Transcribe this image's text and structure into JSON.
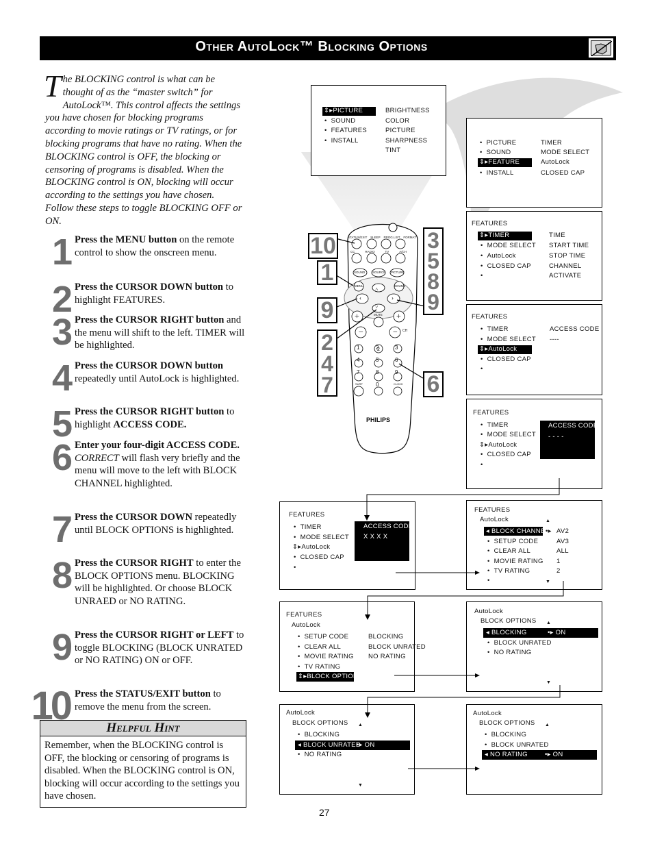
{
  "header": {
    "title": "Other AutoLock™ Blocking Options",
    "icon": "no-hand-icon"
  },
  "intro": {
    "dropcap": "T",
    "text": "he BLOCKING control is what can be thought of as the “master switch” for AutoLock™. This control affects the settings you have chosen for blocking programs according to movie ratings or TV ratings, or for blocking programs that have no rating. When the BLOCKING control is OFF, the blocking or censoring of programs is disabled. When the BLOCKING control is ON, blocking will occur according to the settings you have chosen. Follow these steps to toggle BLOCKING OFF or ON."
  },
  "steps": [
    {
      "num": "1",
      "bold": "Press the MENU button",
      "text": " on the remote control to show the onscreen menu."
    },
    {
      "num": "2",
      "bold": "Press the CURSOR DOWN button",
      "text": " to highlight FEATURES."
    },
    {
      "num": "3",
      "bold": "Press the CURSOR RIGHT button",
      "text": " and the menu will shift to the left. TIMER will be highlighted."
    },
    {
      "num": "4",
      "bold": "Press the CURSOR DOWN button",
      "text": " repeatedly until AutoLock is highlighted."
    },
    {
      "num": "5",
      "bold": "Press the CURSOR RIGHT button",
      "text": " to highlight ",
      "bold2": "ACCESS CODE."
    },
    {
      "num": "6",
      "bold": "Enter your four-digit ACCESS CODE.",
      "italic": " CORRECT",
      "text": " will flash very briefly and the menu will move to the left with BLOCK CHANNEL highlighted."
    },
    {
      "num": "7",
      "bold": "Press the CURSOR DOWN",
      "text": " repeatedly until BLOCK OPTIONS is highlighted."
    },
    {
      "num": "8",
      "bold": "Press the CURSOR RIGHT",
      "text": " to enter the BLOCK OPTIONS menu. BLOCKING will be highlighted. Or choose BLOCK UNRAED or NO RATING."
    },
    {
      "num": "9",
      "bold": "Press the CURSOR RIGHT or LEFT",
      "text": " to toggle BLOCKING (BLOCK UNRATED or NO RATING) ON or OFF."
    },
    {
      "num": "10",
      "bold": "Press the STATUS/EXIT button",
      "text": " to remove the menu from the screen."
    }
  ],
  "hint": {
    "title": "Helpful Hint",
    "text": "Remember, when the BLOCKING control is OFF, the blocking or censoring of programs is disabled. When the BLOCKING control is ON, blocking will occur according to the settings you have chosen."
  },
  "remote": {
    "brand": "PHILIPS",
    "top_labels": [
      "STATUS/EXIT",
      "SLEEP",
      "PROG.LIST",
      "FORMAT"
    ],
    "second_labels": [
      "CC",
      "RADIO",
      "TV",
      "A/CH"
    ],
    "oval_buttons": [
      "SOUND",
      "SOURCE",
      "PICTURE"
    ],
    "oval_top_labels": [
      "AUTO",
      "",
      "AUTO"
    ],
    "menu_label": "MENU",
    "sound_label": "SOUND",
    "mute_label": "MUTE",
    "ch_label": "CH",
    "digits": [
      "1",
      "2",
      "3",
      "4",
      "5",
      "6",
      "7",
      "8",
      "9",
      "",
      "0",
      ""
    ],
    "surf_label": "SURF",
    "clock_label": "CLOCK",
    "callouts": {
      "left_top": "10",
      "left_mid": "1",
      "left_nine": "9",
      "left_bottom": [
        "2",
        "4",
        "7"
      ],
      "right_top": [
        "3",
        "5",
        "8",
        "9"
      ],
      "right_bottom": "6"
    }
  },
  "screens": {
    "s1": {
      "left": [
        "PICTURE",
        "SOUND",
        "FEATURES",
        "INSTALL"
      ],
      "highlight": 0,
      "right": [
        "BRIGHTNESS",
        "COLOR",
        "PICTURE",
        "SHARPNESS",
        "TINT"
      ]
    },
    "s2": {
      "left": [
        "PICTURE",
        "SOUND",
        "FEATURE",
        "INSTALL"
      ],
      "highlight": 2,
      "right": [
        "TIMER",
        "MODE SELECT",
        "AutoLock",
        "CLOSED CAP"
      ]
    },
    "s3": {
      "title": "FEATURES",
      "left": [
        "TIMER",
        "MODE SELECT",
        "AutoLock",
        "CLOSED CAP",
        ""
      ],
      "highlight": 0,
      "right": [
        "TIME",
        "START TIME",
        "STOP TIME",
        "CHANNEL",
        "ACTIVATE"
      ]
    },
    "s4": {
      "title": "FEATURES",
      "left": [
        "TIMER",
        "MODE SELECT",
        "AutoLock",
        "CLOSED CAP",
        ""
      ],
      "highlight": 2,
      "right_title": "ACCESS CODE",
      "right_value": "----"
    },
    "s5": {
      "title": "FEATURES",
      "left": [
        "TIMER",
        "MODE SELECT",
        "AutoLock",
        "CLOSED CAP",
        ""
      ],
      "box_title": "ACCESS CODE",
      "box_value": "- - - -"
    },
    "s6": {
      "title": "FEATURES",
      "left": [
        "TIMER",
        "MODE SELECT",
        "AutoLock",
        "CLOSED CAP",
        ""
      ],
      "box_title": "ACCESS CODE",
      "box_value": "X X X X"
    },
    "s7": {
      "title": "FEATURES",
      "subtitle": "AutoLock",
      "left": [
        "BLOCK CHANNEL",
        "SETUP CODE",
        "CLEAR ALL",
        "MOVIE RATING",
        "TV RATING",
        ""
      ],
      "right": [
        "AV2",
        "AV3",
        "ALL",
        "1",
        "2"
      ]
    },
    "s8": {
      "title": "FEATURES",
      "subtitle": "AutoLock",
      "left": [
        "SETUP CODE",
        "CLEAR ALL",
        "MOVIE RATING",
        "TV RATING",
        "BLOCK OPTIONS"
      ],
      "right": [
        "BLOCKING",
        "BLOCK UNRATED",
        "NO RATING"
      ]
    },
    "s9": {
      "title": "AutoLock",
      "subtitle": "BLOCK OPTIONS",
      "items": [
        "BLOCKING",
        "BLOCK UNRATED",
        "NO RATING"
      ],
      "highlight": 0,
      "value": "ON"
    },
    "s10": {
      "title": "AutoLock",
      "subtitle": "BLOCK OPTIONS",
      "items": [
        "BLOCKING",
        "BLOCK UNRATED",
        "NO RATING"
      ],
      "highlight": 1,
      "value": "ON"
    },
    "s11": {
      "title": "AutoLock",
      "subtitle": "BLOCK OPTIONS",
      "items": [
        "BLOCKING",
        "BLOCK UNRATED",
        "NO RATING"
      ],
      "highlight": 2,
      "value": "ON"
    }
  },
  "page_number": "27"
}
